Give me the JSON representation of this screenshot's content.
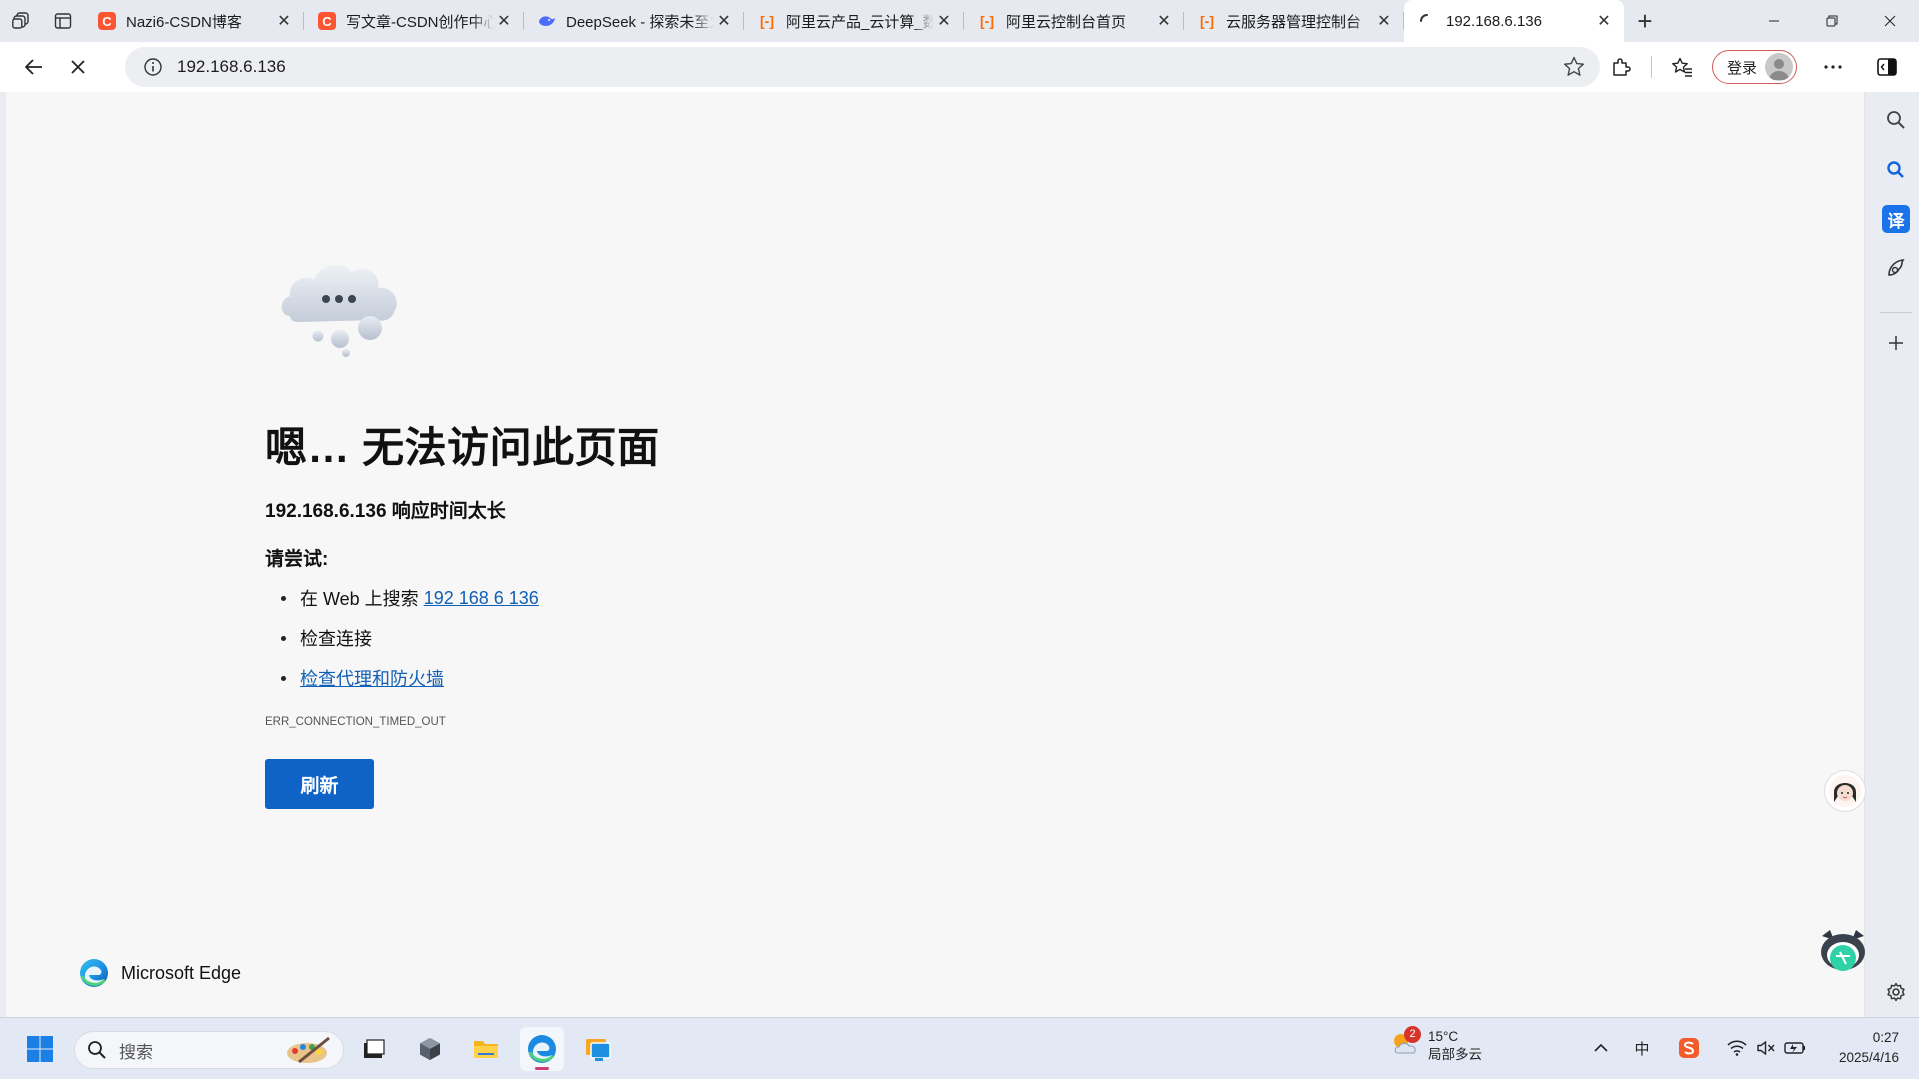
{
  "tabs": [
    {
      "title": "Nazi6-CSDN博客",
      "favicon": "csdn-icon",
      "color": "#fc5531"
    },
    {
      "title": "写文章-CSDN创作中心",
      "favicon": "csdn-icon",
      "color": "#fc5531"
    },
    {
      "title": "DeepSeek - 探索未至之境",
      "favicon": "deepseek-icon",
      "color": "#4d6bfe"
    },
    {
      "title": "阿里云产品_云计算_数据",
      "favicon": "aliyun-icon",
      "color": "#ff6a00"
    },
    {
      "title": "阿里云控制台首页",
      "favicon": "aliyun-icon",
      "color": "#ff6a00"
    },
    {
      "title": "云服务器管理控制台",
      "favicon": "aliyun-icon",
      "color": "#ff6a00"
    },
    {
      "title": "192.168.6.136",
      "favicon": "loading-icon",
      "active": true
    }
  ],
  "address_bar": {
    "url": "192.168.6.136"
  },
  "toolbar": {
    "login_label": "登录"
  },
  "error_page": {
    "title": "嗯… 无法访问此页面",
    "subtitle": "192.168.6.136 响应时间太长",
    "try_label": "请尝试:",
    "suggestions": {
      "search_prefix": "在 Web 上搜索 ",
      "search_link": "192 168 6 136",
      "check_connection": "检查连接",
      "check_proxy": "检查代理和防火墙"
    },
    "error_code": "ERR_CONNECTION_TIMED_OUT",
    "refresh_label": "刷新",
    "brand": "Microsoft Edge"
  },
  "taskbar": {
    "search_placeholder": "搜索",
    "weather": {
      "badge": "2",
      "temp": "15°C",
      "desc": "局部多云"
    },
    "ime": "中",
    "time": "0:27",
    "date": "2025/4/16"
  },
  "colors": {
    "accent": "#0f63c6",
    "link": "#1160b7",
    "csdn": "#fc5531",
    "aliyun": "#ff6a00"
  }
}
